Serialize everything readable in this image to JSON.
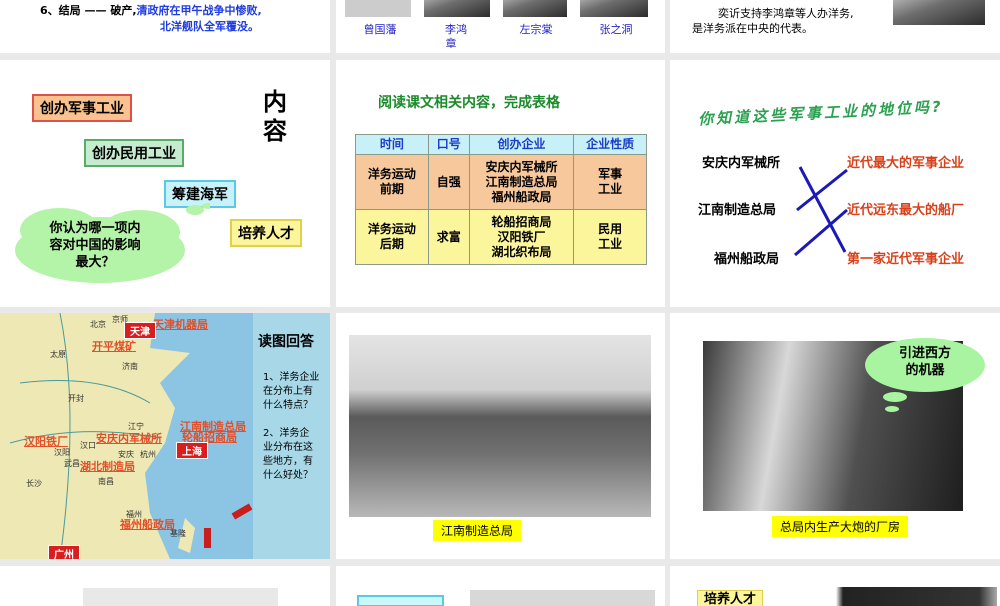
{
  "slide1": {
    "prefix": "6、结局 —— 破产,",
    "text1": "清政府在甲午战争中惨败,",
    "text2": "北洋舰队全军覆没。"
  },
  "slide2": {
    "names": [
      "曾国藩",
      "李鸿",
      "章",
      "左宗棠",
      "张之洞"
    ]
  },
  "slide3": {
    "line1": "奕䜣支持李鸿章等人办洋务,",
    "line2": "是洋务派在中央的代表。"
  },
  "slide4": {
    "title": "内容",
    "boxes": [
      "创办军事工业",
      "创办民用工业",
      "筹建海军",
      "培养人才"
    ],
    "cloud": [
      "你认为哪一项内",
      "容对中国的影响",
      "最大？"
    ],
    "colors": {
      "military": "#f9c28e",
      "civil": "#c6ecd0",
      "navy": "#c8f2fa",
      "talent": "#fbf59c"
    }
  },
  "slide5": {
    "title": "阅读课文相关内容，完成表格",
    "headers": [
      "时间",
      "口号",
      "创办企业",
      "企业性质"
    ],
    "rows": [
      {
        "time": [
          "洋务运动",
          "前期"
        ],
        "slogan": "自强",
        "companies": [
          "安庆内军械所",
          "江南制造总局",
          "福州船政局"
        ],
        "nature": [
          "军事",
          "工业"
        ]
      },
      {
        "time": [
          "洋务运动",
          "后期"
        ],
        "slogan": "求富",
        "companies": [
          "轮船招商局",
          "汉阳铁厂",
          "湖北织布局"
        ],
        "nature": [
          "民用",
          "工业"
        ]
      }
    ]
  },
  "slide6": {
    "title": "你知道这些军事工业的地位吗?",
    "left": [
      "安庆内军械所",
      "江南制造总局",
      "福州船政局"
    ],
    "right": [
      "近代最大的军事企业",
      "近代远东最大的船厂",
      "第一家近代军事企业"
    ]
  },
  "slide7": {
    "map_labels": [
      "天津机器局",
      "开平煤矿",
      "汉阳铁厂",
      "安庆内军械所",
      "江南制造总局",
      "轮船招商局",
      "湖北制造局",
      "福州船政局"
    ],
    "cities": [
      "天津",
      "上海",
      "广州"
    ],
    "places": [
      "京师",
      "北京",
      "太原",
      "济南",
      "开封",
      "江宁",
      "汉口",
      "汉阳",
      "武昌",
      "安庆",
      "杭州",
      "长沙",
      "南昌",
      "福州",
      "基隆"
    ],
    "heading": "读图回答",
    "q1": [
      "1、洋务企业",
      "在分布上有",
      "什么特点？"
    ],
    "q2": [
      "2、洋务企",
      "业分布在这",
      "些地方，有",
      "什么好处？"
    ]
  },
  "slide8": {
    "caption": "江南制造总局"
  },
  "slide9": {
    "caption": "总局内生产大炮的厂房",
    "cloud": [
      "引进西方",
      "的机器"
    ]
  },
  "slide12": {
    "box": "培养人才"
  }
}
